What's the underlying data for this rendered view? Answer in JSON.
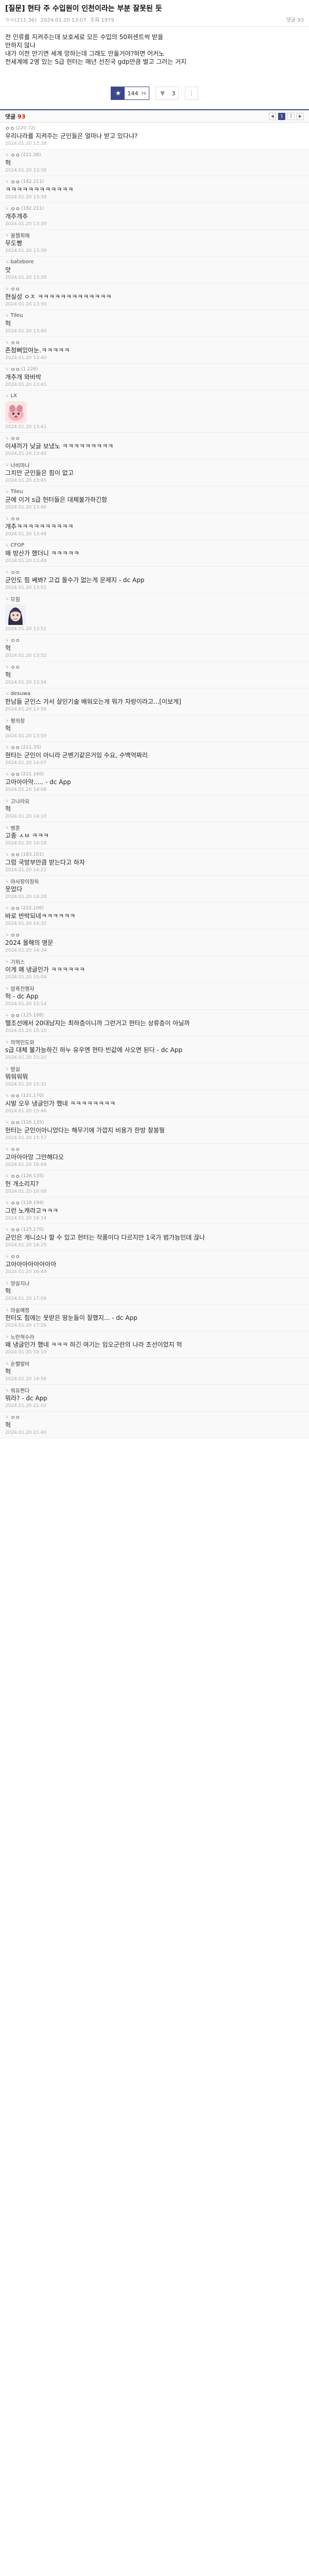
{
  "post": {
    "title": "[질문] 현타 주 수입원이 인천이라는 부분 잘못된 듯",
    "author": "ㅇㅇ(211.36)",
    "date": "2024.01.20 13:07",
    "views": "조회 1979",
    "comment_short": "댓글 93",
    "body": [
      "전 인류를 지켜주는데 보호세로 모든 수입의 50퍼센트씩 받을",
      "만하지 않나",
      "내가 이전 만기면 세계 망하는데 그래도 만둘거야?하면 어커노",
      "전세계에 2명 있는 S급 헌터는 매년 선진국 gdp만큼 벌고 그러는 거지"
    ],
    "upvotes": "144",
    "upvotes_fixed": "76",
    "downvotes": "3"
  },
  "comment_bar": {
    "label": "댓글",
    "count": "93",
    "pages": [
      "1",
      "2"
    ],
    "active_page": "1"
  },
  "comments": [
    {
      "reply": false,
      "nick": "ㅇㅇ",
      "ip": "(220.72)",
      "text": "우리나라를 지켜주는 군인들은 얼마나 받고 있다냐?",
      "time": "2024.01.20 13:38"
    },
    {
      "reply": true,
      "nick": "ㅇㅇ",
      "ip": "(211.36)",
      "text": "헉",
      "time": "2024.01.20 13:38"
    },
    {
      "reply": true,
      "nick": "ㅇㅇ",
      "ip": "(182.211)",
      "text": "ㅋㅋㅋㅋㅋㅋㅋㅋㅋㅋㅋㅋ",
      "time": "2024.01.20 13:39"
    },
    {
      "reply": true,
      "nick": "ㅇㅇ",
      "ip": "(182.211)",
      "text": "개추개추",
      "time": "2024.01.20 13:39"
    },
    {
      "reply": true,
      "nick": "꿀잼최애",
      "ip": "",
      "text": "무도빵",
      "time": "2024.01.20 13:39"
    },
    {
      "reply": true,
      "nick": "batebore",
      "ip": "",
      "text": "앗",
      "time": "2024.01.20 13:39"
    },
    {
      "reply": true,
      "nick": "ㅇㅇ",
      "ip": "",
      "text": "현실성 ㅇㅈ ㅋㅋㅋㅋㅋㅋㅋㅋㅋㅋㅋㅋㅋ",
      "time": "2024.01.20 13:39"
    },
    {
      "reply": true,
      "nick": "Tileu",
      "ip": "",
      "text": "헉",
      "time": "2024.01.20 13:40"
    },
    {
      "reply": true,
      "nick": "ㅇㅇ",
      "ip": "",
      "text": "존첨삐있아눈.ㅋㅋㅋㅋㅋ",
      "time": "2024.01.20 13:40"
    },
    {
      "reply": true,
      "nick": "ㅇㅇ",
      "ip": "(1.226)",
      "text": "개추개 와바박",
      "time": "2024.01.20 13:41"
    },
    {
      "reply": true,
      "nick": "LX",
      "ip": "",
      "text": "",
      "dccon": "pink",
      "time": "2024.01.20 13:41"
    },
    {
      "reply": true,
      "nick": "ㅇㅇ",
      "ip": "",
      "text": "이새끼가 낮글 보냈노 ㅋㅋㅋㅋㅋㅋㅋㅋㅋ",
      "time": "2024.01.20 13:45"
    },
    {
      "reply": true,
      "nick": "나비마나",
      "ip": "",
      "text": "그치만 군인들은 힘이 없고",
      "time": "2024.01.20 13:45"
    },
    {
      "reply": true,
      "nick": "Tileu",
      "ip": "",
      "text": "군에 이거 s급 헌터들은 대체불가하긴함",
      "time": "2024.01.20 13:46"
    },
    {
      "reply": true,
      "nick": "ㅇㅇ",
      "ip": "",
      "text": "개추ㅋㅋㅋㅋㅋㅋㅋㅋㅋㅋ",
      "time": "2024.01.20 13:48"
    },
    {
      "reply": true,
      "nick": "CFOP",
      "ip": "",
      "text": "왜 방산가 했더니 ㅋㅋㅋㅋㅋ",
      "time": "2024.01.20 13:49"
    },
    {
      "reply": true,
      "nick": "ㅇㅇ",
      "ip": "",
      "text": "군인도 힘 쎄봐? 고겁 올수가 없는게 문제지 - dc App",
      "time": "2024.01.20 13:51"
    },
    {
      "reply": true,
      "nick": "모힘",
      "ip": "",
      "text": "",
      "dccon": "girl",
      "time": "2024.01.20 13:51"
    },
    {
      "reply": true,
      "nick": "ㅇㅇ",
      "ip": "",
      "text": "헉",
      "time": "2024.01.20 13:52"
    },
    {
      "reply": true,
      "nick": "ㅇㅇ",
      "ip": "",
      "text": "헉",
      "time": "2024.01.20 13:54"
    },
    {
      "reply": true,
      "nick": "desuwa",
      "ip": "",
      "text": "한남들 군인스 가서 살인기술 배워오는게 뭐가 자랑이라고...[이보게]",
      "time": "2024.01.20 13:56"
    },
    {
      "reply": true,
      "nick": "평의장",
      "ip": "",
      "text": "헉",
      "time": "2024.01.20 13:59"
    },
    {
      "reply": true,
      "nick": "ㅇㅇ",
      "ip": "(211.35)",
      "text": "현타는 군인이 아니라 군벤기같은거임 수요, 수백억짜리",
      "time": "2024.01.20 14:07"
    },
    {
      "reply": true,
      "nick": "ㅇㅇ",
      "ip": "(221.160)",
      "text": "고아아아악..... - dc App",
      "time": "2024.01.20 14:08"
    },
    {
      "reply": true,
      "nick": "고나라요",
      "ip": "",
      "text": "헉",
      "time": "2024.01.20 14:10"
    },
    {
      "reply": true,
      "nick": "병훈",
      "ip": "",
      "text": "고종 ㅅㅂ ㅋㅋㅋ",
      "time": "2024.01.20 14:18"
    },
    {
      "reply": true,
      "nick": "ㅇㅇ",
      "ip": "(183.101)",
      "text": "그럼 국방부만큼 받는다고 하자",
      "time": "2024.01.20 14:22"
    },
    {
      "reply": true,
      "nick": "마사장이장득",
      "ip": "",
      "text": "웃었다",
      "time": "2024.01.20 14:28"
    },
    {
      "reply": true,
      "nick": "ㅇㅇ",
      "ip": "(222.106)",
      "text": "바로 반박되네ㅋㅋㅋㅋㅋㅋ",
      "time": "2024.01.20 14:32"
    },
    {
      "reply": true,
      "nick": "ㅇㅇ",
      "ip": "",
      "text": "2024 올해의 명문",
      "time": "2024.01.20 14:34"
    },
    {
      "reply": true,
      "nick": "기위스",
      "ip": "",
      "text": "이게 왜 냉글인가 ㅋㅋㅋㅋㅋㅋ",
      "time": "2024.01.20 15:04"
    },
    {
      "reply": true,
      "nick": "암흑진행자",
      "ip": "",
      "text": "헉 - dc App",
      "time": "2024.01.20 15:14"
    },
    {
      "reply": true,
      "nick": "ㅇㅇ",
      "ip": "(125.188)",
      "text": "헬조선에서 20대남자는 최하층이니까 그런거고 현타는 상류층이 아닐까",
      "time": "2024.01.20 15:15"
    },
    {
      "reply": true,
      "nick": "의역인도와",
      "ip": "",
      "text": "s급 대체 불가능하긴 하누 유우엔 현타 빈값에 사오면 된다 - dc App",
      "time": "2024.01.20 15:20"
    },
    {
      "reply": true,
      "nick": "밤싫",
      "ip": "",
      "text": "뭐워워뭐",
      "time": "2024.01.20 15:32"
    },
    {
      "reply": true,
      "nick": "ㅇㅇ",
      "ip": "(121.170)",
      "text": "시발 오우 냉글인가 했네 ㅋㅋㅋㅋㅋㅋㅋㅋ",
      "time": "2024.01.20 15:46"
    },
    {
      "reply": true,
      "nick": "ㅇㅇ",
      "ip": "(126.135)",
      "text": "헌터는 군인이아니었다는 해무기에 가깝지 비용가 한방 찰봉뭥",
      "time": "2024.01.20 15:57"
    },
    {
      "reply": true,
      "nick": "ㅇㅇ",
      "ip": "",
      "text": "고아아아앙 그만해다오",
      "time": "2024.01.20 16:04"
    },
    {
      "reply": true,
      "nick": "ㅇㅇ",
      "ip": "(126.135)",
      "text": "헌 개소리지?",
      "time": "2024.01.20 16:08"
    },
    {
      "reply": true,
      "nick": "ㅇㅇ",
      "ip": "(118.194)",
      "text": "그런 노캐라고ㅋㅋㅋ",
      "time": "2024.01.20 16:14"
    },
    {
      "reply": true,
      "nick": "ㅇㅇ",
      "ip": "(125.170)",
      "text": "군인은 게니소나 할 수 있고 헌터는 작품이다 다르지만 1국가 범가능인데 끊나",
      "time": "2024.01.20 16:25"
    },
    {
      "reply": true,
      "nick": "ㅇㅇ",
      "ip": "",
      "text": "고아아아아아아아아",
      "time": "2024.01.20 16:49"
    },
    {
      "reply": true,
      "nick": "양살지나",
      "ip": "",
      "text": "헉",
      "time": "2024.01.20 17:09"
    },
    {
      "reply": true,
      "nick": "마술예정",
      "ip": "",
      "text": "헌터도 힘에는 못받은 땅눈들이 잘했지... - dc App",
      "time": "2024.01.20 17:26"
    },
    {
      "reply": true,
      "nick": "노란척수라",
      "ip": "",
      "text": "왜 냉글인가 했네 ㅋㅋㅋ 하긴 여기는 임오군란의 나라 조선이었지 헉",
      "time": "2024.01.20 18:19"
    },
    {
      "reply": true,
      "nick": "순쩔발비",
      "ip": "",
      "text": "헉",
      "time": "2024.01.20 19:56"
    },
    {
      "reply": true,
      "nick": "뭐유쩐다",
      "ip": "",
      "text": "뭐라? - dc App",
      "time": "2024.01.20 21:02"
    },
    {
      "reply": true,
      "nick": "ㅇㅇ",
      "ip": "",
      "text": "헉",
      "time": "2024.01.20 21:40"
    }
  ]
}
